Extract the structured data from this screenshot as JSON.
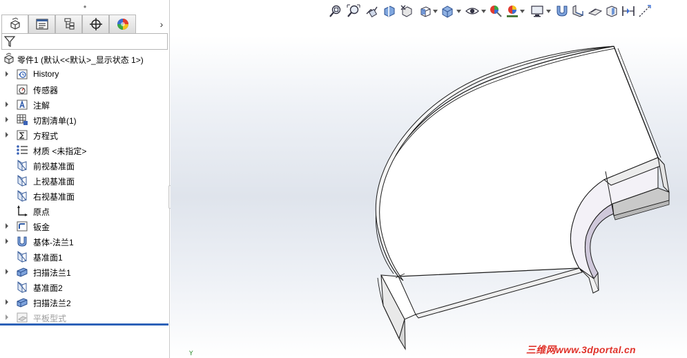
{
  "feature_tree": {
    "root": {
      "label": "零件1  (默认<<默认>_显示状态 1>)",
      "icon": "part-icon"
    },
    "items": [
      {
        "label": "History",
        "icon": "history-folder-icon",
        "expandable": true,
        "disabled": false
      },
      {
        "label": "传感器",
        "icon": "sensors-folder-icon",
        "expandable": false,
        "disabled": false
      },
      {
        "label": "注解",
        "icon": "annotations-folder-icon",
        "expandable": true,
        "disabled": false
      },
      {
        "label": "切割清单(1)",
        "icon": "cut-list-icon",
        "expandable": true,
        "disabled": false
      },
      {
        "label": "方程式",
        "icon": "equations-folder-icon",
        "expandable": true,
        "disabled": false
      },
      {
        "label": "材质 <未指定>",
        "icon": "material-icon",
        "expandable": false,
        "disabled": false
      },
      {
        "label": "前视基准面",
        "icon": "plane-icon",
        "expandable": false,
        "disabled": false
      },
      {
        "label": "上视基准面",
        "icon": "plane-icon",
        "expandable": false,
        "disabled": false
      },
      {
        "label": "右视基准面",
        "icon": "plane-icon",
        "expandable": false,
        "disabled": false
      },
      {
        "label": "原点",
        "icon": "origin-icon",
        "expandable": false,
        "disabled": false
      },
      {
        "label": "钣金",
        "icon": "sheet-metal-folder-icon",
        "expandable": true,
        "disabled": false
      },
      {
        "label": "基体-法兰1",
        "icon": "base-flange-icon",
        "expandable": true,
        "disabled": false
      },
      {
        "label": "基准面1",
        "icon": "plane-icon",
        "expandable": false,
        "disabled": false
      },
      {
        "label": "扫描法兰1",
        "icon": "swept-flange-icon",
        "expandable": true,
        "disabled": false
      },
      {
        "label": "基准面2",
        "icon": "plane-icon",
        "expandable": false,
        "disabled": false
      },
      {
        "label": "扫描法兰2",
        "icon": "swept-flange-icon",
        "expandable": true,
        "disabled": false
      },
      {
        "label": "平板型式",
        "icon": "flat-pattern-icon",
        "expandable": true,
        "disabled": true
      }
    ]
  },
  "tabs": [
    {
      "name": "featuremanager",
      "icon": "featuremanager-icon",
      "active": true
    },
    {
      "name": "propertymanager",
      "icon": "propertymanager-icon",
      "active": false
    },
    {
      "name": "configurationmanager",
      "icon": "configurationmanager-icon",
      "active": false
    },
    {
      "name": "dimxpert",
      "icon": "dimxpert-icon",
      "active": false
    },
    {
      "name": "displaymanager",
      "icon": "displaymanager-icon",
      "active": false
    }
  ],
  "tab_scroll_glyph": "›",
  "panel_grip_glyph": "●",
  "heads_up_toolbar": [
    "zoom-to-fit-icon",
    "zoom-to-area-icon",
    "previous-view-icon",
    "section-view-icon",
    "dynamic-annotation-icon",
    "view-orientation-icon",
    "display-style-icon",
    "hide-show-items-icon",
    "edit-appearance-icon",
    "apply-scene-icon",
    "view-settings-icon",
    "sheet-metal-bend-icon",
    "sheet-metal-insert-icon",
    "flatten-icon",
    "no-bends-icon",
    "unfold-icon",
    "rip-icon"
  ],
  "triad_label": "Y",
  "watermark": "三维网www.3dportal.cn",
  "colors": {
    "selection_bar": "#2c62b8",
    "watermark": "#e0322a",
    "viewport_gradient_mid": "#dfe4ec"
  }
}
